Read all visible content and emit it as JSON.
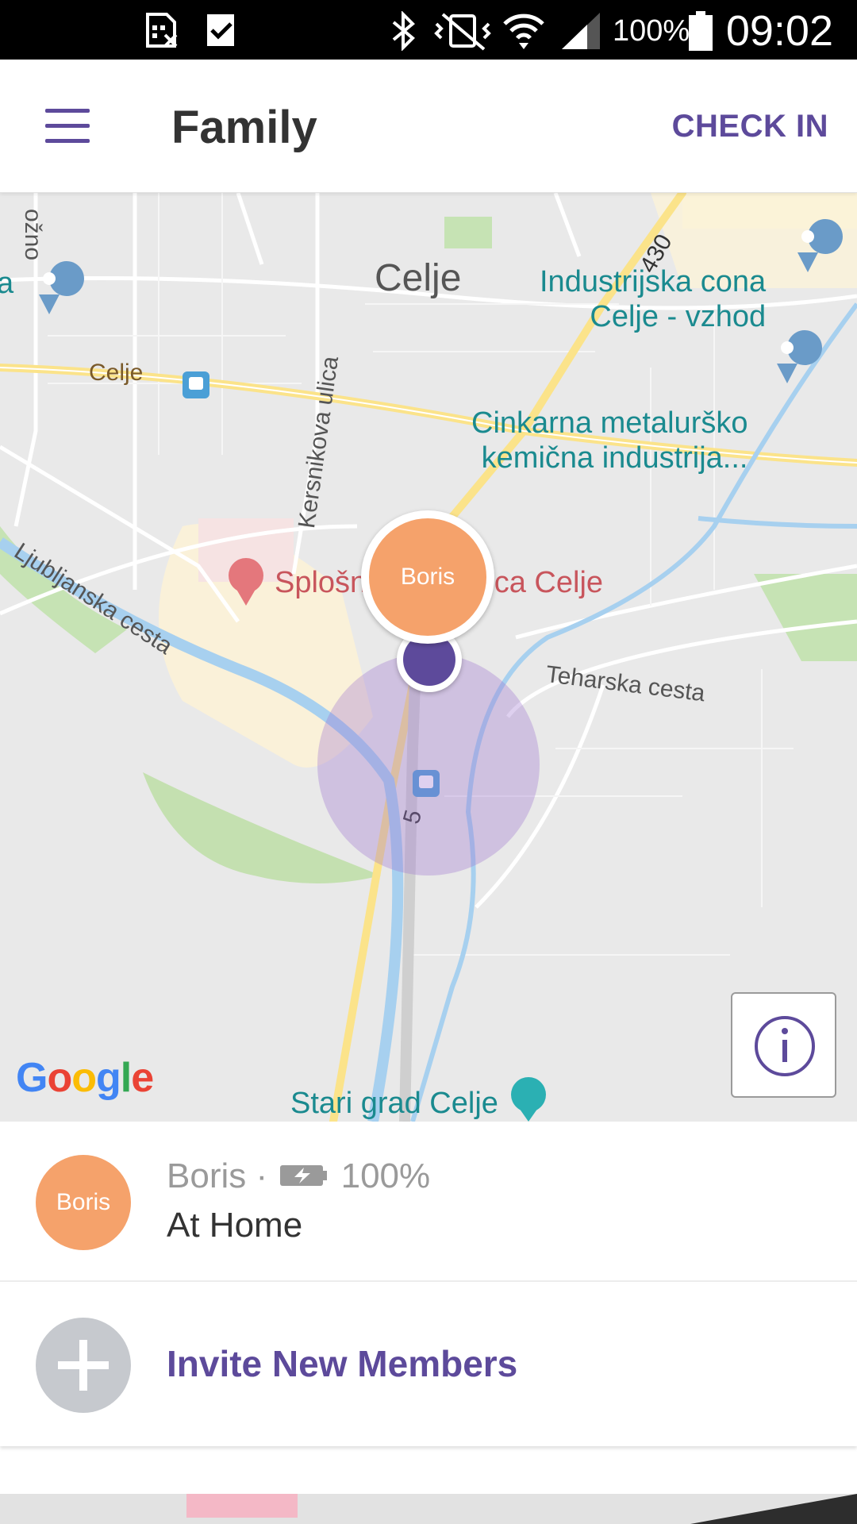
{
  "status_bar": {
    "battery_percent": "100%",
    "time": "09:02",
    "icons": [
      "sim-missing-icon",
      "task-done-icon",
      "bluetooth-icon",
      "vibrate-icon",
      "wifi-icon",
      "signal-icon",
      "battery-icon"
    ]
  },
  "app_bar": {
    "title": "Family",
    "check_in_label": "CHECK IN",
    "accent_color": "#5d4a9b"
  },
  "map": {
    "labels": {
      "city": "Celje",
      "road_celje": "Celje",
      "kersnikova": "Kersnikova ulica",
      "ljubljanska": "Ljubljanska cesta",
      "teharska": "Teharska cesta",
      "road_430": "430",
      "road_5": "5",
      "left_edge_1": "ožno",
      "left_edge_2": "a",
      "industrijska": "Industrijska cona\nCelje - vzhod",
      "cinkarna": "Cinkarna metalurško\nkemična industrija...",
      "hospital": "Splošna bolnišnica Celje",
      "stari_grad": "Stari grad Celje"
    },
    "member_pin_label": "Boris",
    "attribution": "Google"
  },
  "members": [
    {
      "name": "Boris",
      "avatar_label": "Boris",
      "separator": "·",
      "battery": "100%",
      "status": "At Home",
      "avatar_color": "#f5a26b"
    }
  ],
  "invite": {
    "label": "Invite New Members"
  }
}
